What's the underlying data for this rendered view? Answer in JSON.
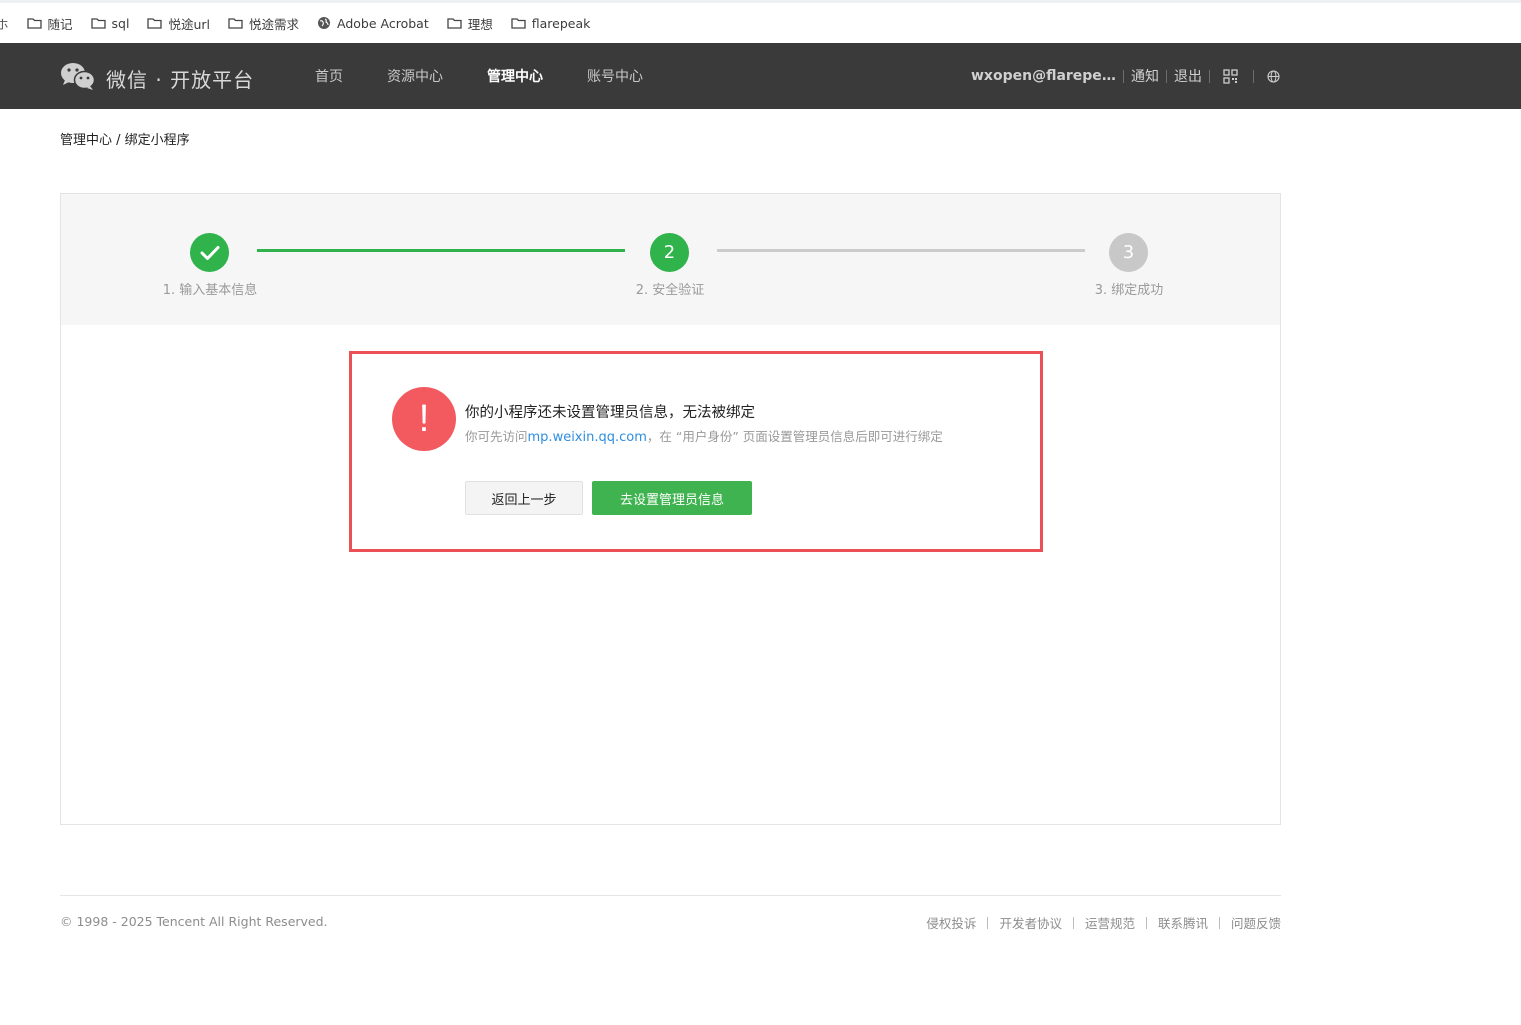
{
  "bookmarks": {
    "cut_label": "ホ",
    "items": [
      {
        "label": "随记",
        "icon": "folder-icon"
      },
      {
        "label": "sql",
        "icon": "folder-icon"
      },
      {
        "label": "悦途url",
        "icon": "folder-icon"
      },
      {
        "label": "悦途需求",
        "icon": "folder-icon"
      },
      {
        "label": "Adobe Acrobat",
        "icon": "globe-icon"
      },
      {
        "label": "理想",
        "icon": "folder-icon"
      },
      {
        "label": "flarepeak",
        "icon": "folder-icon"
      }
    ]
  },
  "header": {
    "brand": "微信 · 开放平台",
    "nav": [
      "首页",
      "资源中心",
      "管理中心",
      "账号中心"
    ],
    "active_nav": "管理中心",
    "user": "wxopen@flarepeak...",
    "notify": "通知",
    "logout": "退出",
    "icons": [
      "qrcode-icon",
      "globe-icon"
    ],
    "bg_color": "#3a3a3a"
  },
  "breadcrumb": "管理中心 / 绑定小程序",
  "steps": [
    {
      "number": "✓",
      "label": "1. 输入基本信息",
      "state": "done"
    },
    {
      "number": "2",
      "label": "2. 安全验证",
      "state": "current"
    },
    {
      "number": "3",
      "label": "3. 绑定成功",
      "state": "todo"
    }
  ],
  "alert": {
    "icon": "!",
    "title": "你的小程序还未设置管理员信息，无法被绑定",
    "desc_prefix": "你可先访问",
    "desc_link": "mp.weixin.qq.com",
    "desc_suffix": "，在 “用户身份” 页面设置管理员信息后即可进行绑定",
    "back_button": "返回上一步",
    "go_button": "去设置管理员信息",
    "border_color": "#ea5055",
    "primary_color": "#3fb34f"
  },
  "footer": {
    "copyright": "© 1998 - 2025 Tencent All Right Reserved.",
    "links": [
      "侵权投诉",
      "开发者协议",
      "运营规范",
      "联系腾讯",
      "问题反馈"
    ]
  }
}
